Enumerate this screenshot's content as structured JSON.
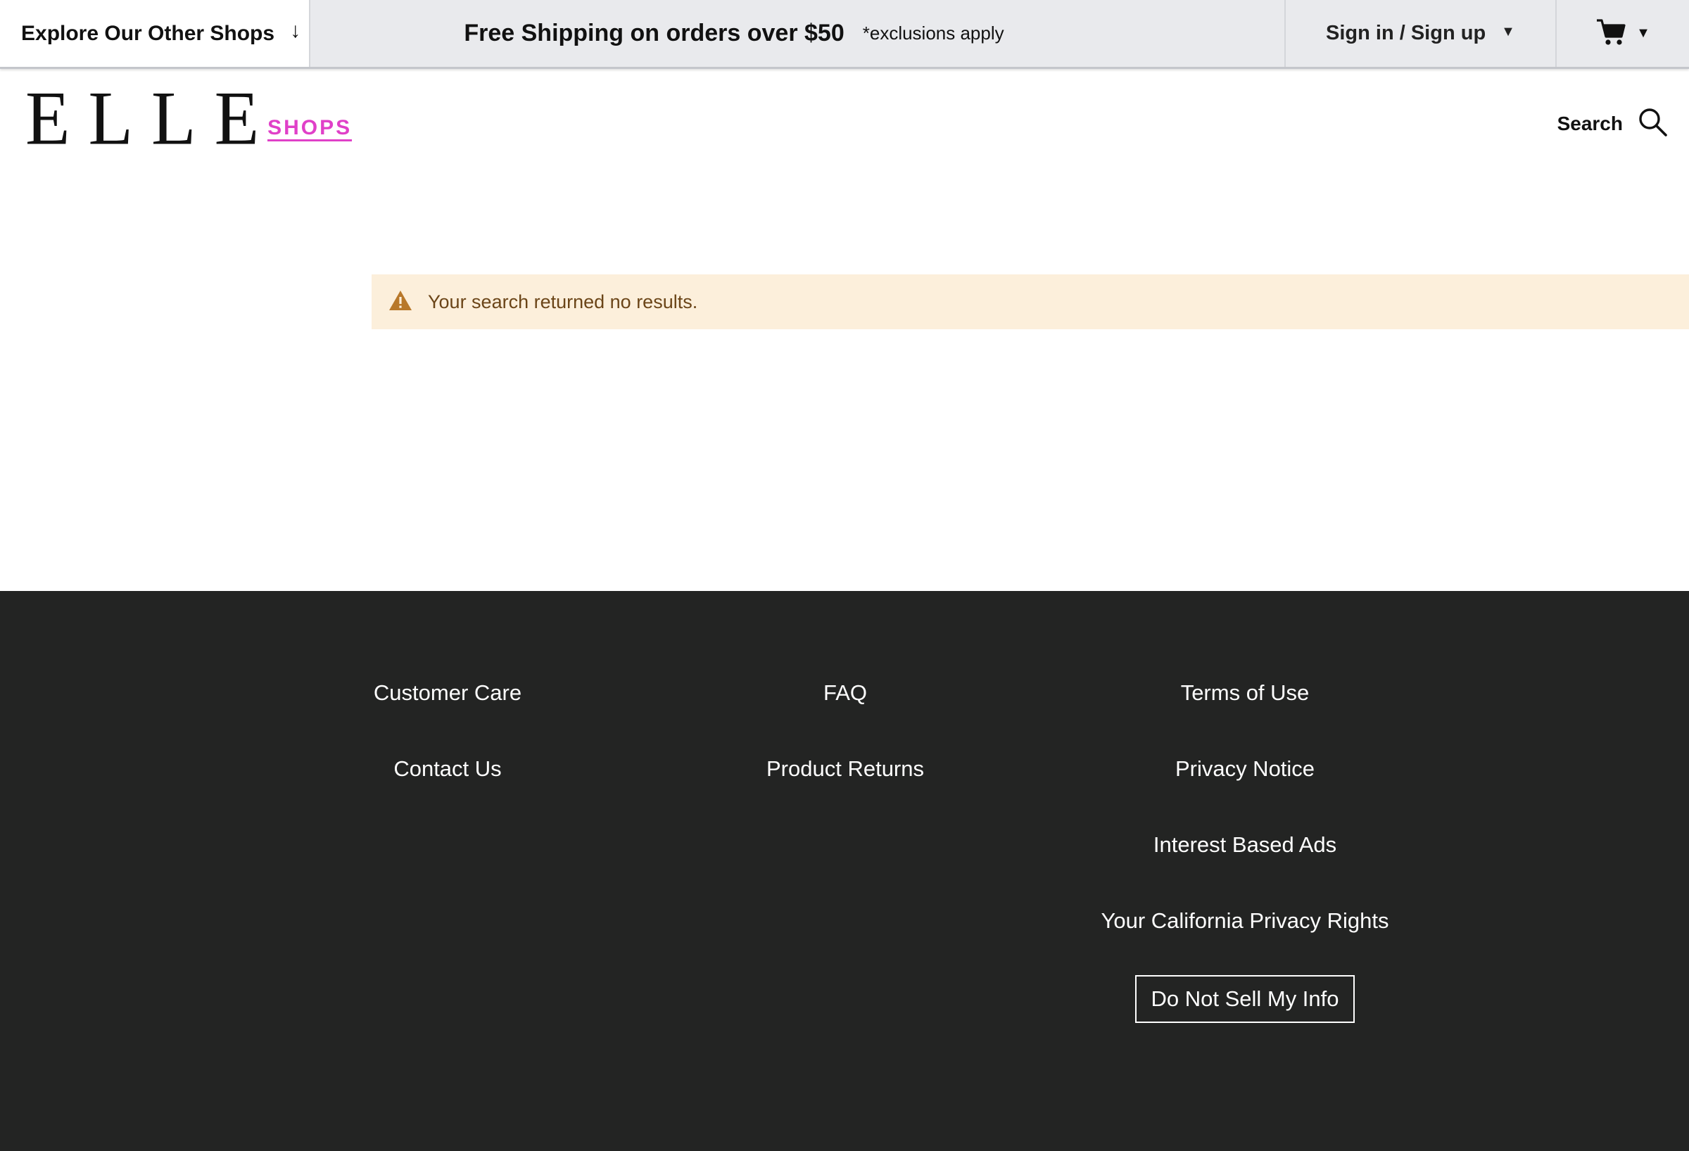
{
  "topbar": {
    "explore_label": "Explore Our Other Shops",
    "explore_arrow": "↓",
    "promo_main": "Free Shipping on orders over $50",
    "promo_fine": "*exclusions apply",
    "signin_label": "Sign in / Sign up",
    "caret": "▼"
  },
  "header": {
    "logo_text": "ELLE",
    "logo_sub": "SHOPS",
    "search_label": "Search"
  },
  "alert": {
    "message": "Your search returned no results."
  },
  "footer": {
    "col1": [
      "Customer Care",
      "Contact Us"
    ],
    "col2": [
      "FAQ",
      "Product Returns"
    ],
    "col3": [
      "Terms of Use",
      "Privacy Notice",
      "Interest Based Ads",
      "Your California Privacy Rights"
    ],
    "do_not_sell": "Do Not Sell My Info"
  },
  "colors": {
    "topbar_bg": "#e9eaed",
    "brand_pink": "#e040c8",
    "alert_bg": "#fcefdb",
    "alert_icon": "#b8782a",
    "footer_bg": "#232423"
  },
  "icons": {
    "cart": "cart-icon",
    "search": "search-icon",
    "warning": "warning-icon"
  }
}
